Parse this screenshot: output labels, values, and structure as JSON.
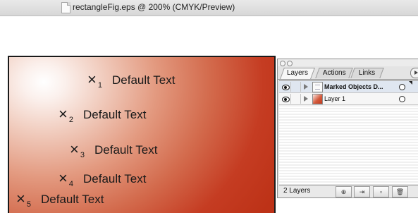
{
  "document": {
    "title": "rectangleFig.eps @ 200% (CMYK/Preview)"
  },
  "artwork": {
    "text_lines": [
      {
        "subscript": "1",
        "text": "Default Text"
      },
      {
        "subscript": "2",
        "text": "Default Text"
      },
      {
        "subscript": "3",
        "text": "Default Text"
      },
      {
        "subscript": "4",
        "text": "Default Text"
      },
      {
        "subscript": "5",
        "text": "Default Text"
      }
    ],
    "x_glyph": "×"
  },
  "layers_palette": {
    "tabs": [
      {
        "label": "Layers",
        "active": true
      },
      {
        "label": "Actions",
        "active": false
      },
      {
        "label": "Links",
        "active": false
      }
    ],
    "layers": [
      {
        "name": "Marked Objects D...",
        "visible": true,
        "selected": true,
        "expanded": false
      },
      {
        "name": "Layer 1",
        "visible": true,
        "selected": false,
        "expanded": false
      }
    ],
    "footer": {
      "count_label": "2 Layers",
      "buttons": [
        "make-clipping-mask",
        "new-sublayer",
        "new-layer",
        "delete-layer"
      ]
    }
  },
  "colors": {
    "gradient_highlight": "#ffffff",
    "gradient_base": "#c53c22"
  }
}
